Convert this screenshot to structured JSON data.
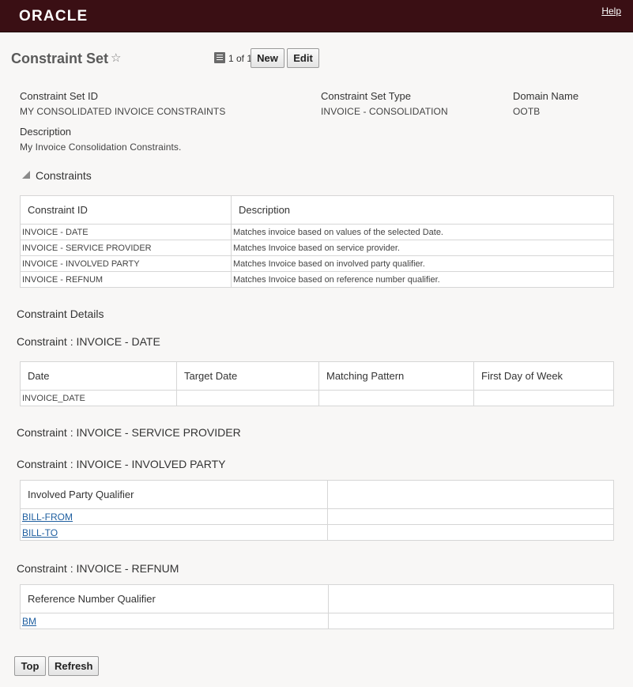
{
  "header": {
    "logo": "ORACLE",
    "help": "Help"
  },
  "page": {
    "title": "Constraint Set",
    "pager": "1 of 1",
    "new_label": "New",
    "edit_label": "Edit"
  },
  "fields": {
    "set_id_label": "Constraint Set ID",
    "set_id_value": "MY CONSOLIDATED INVOICE CONSTRAINTS",
    "set_type_label": "Constraint Set Type",
    "set_type_value": "INVOICE - CONSOLIDATION",
    "domain_label": "Domain Name",
    "domain_value": "OOTB",
    "description_label": "Description",
    "description_value": "My Invoice Consolidation Constraints."
  },
  "constraints": {
    "title": "Constraints",
    "columns": [
      "Constraint ID",
      "Description"
    ],
    "rows": [
      [
        "INVOICE - DATE",
        "Matches invoice based on values of the selected Date."
      ],
      [
        "INVOICE - SERVICE PROVIDER",
        "Matches Invoice based on service provider."
      ],
      [
        "INVOICE - INVOLVED PARTY",
        "Matches Invoice based on involved party qualifier."
      ],
      [
        "INVOICE - REFNUM",
        "Matches Invoice based on reference number qualifier."
      ]
    ]
  },
  "details": {
    "title": "Constraint Details",
    "date_heading": "Constraint : INVOICE - DATE",
    "date_columns": [
      "Date",
      "Target Date",
      "Matching Pattern",
      "First Day of Week"
    ],
    "date_rows": [
      [
        "INVOICE_DATE",
        "",
        "",
        ""
      ]
    ],
    "sp_heading": "Constraint : INVOICE - SERVICE PROVIDER",
    "party_heading": "Constraint : INVOICE - INVOLVED PARTY",
    "party_columns": [
      "Involved Party Qualifier",
      ""
    ],
    "party_rows": [
      [
        "BILL-FROM",
        ""
      ],
      [
        "BILL-TO",
        ""
      ]
    ],
    "ref_heading": "Constraint : INVOICE - REFNUM",
    "ref_columns": [
      "Reference Number Qualifier",
      ""
    ],
    "ref_rows": [
      [
        "BM",
        ""
      ]
    ]
  },
  "footer": {
    "top_label": "Top",
    "refresh_label": "Refresh"
  }
}
